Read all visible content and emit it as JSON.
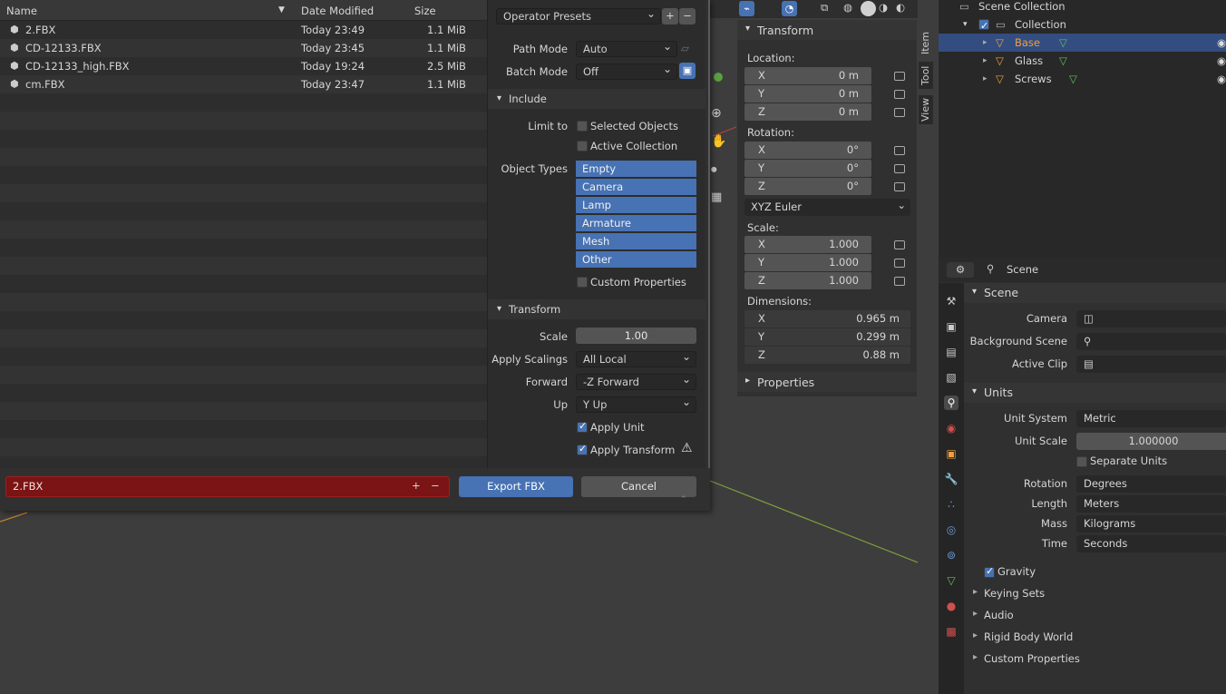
{
  "file_browser": {
    "columns": {
      "name": "Name",
      "date": "Date Modified",
      "size": "Size"
    },
    "files": [
      {
        "name": "2.FBX",
        "date": "Today 23:49",
        "size": "1.1 MiB"
      },
      {
        "name": "CD-12133.FBX",
        "date": "Today 23:45",
        "size": "1.1 MiB"
      },
      {
        "name": "CD-12133_high.FBX",
        "date": "Today 19:24",
        "size": "2.5 MiB"
      },
      {
        "name": "cm.FBX",
        "date": "Today 23:47",
        "size": "1.1 MiB"
      }
    ],
    "filename": "2.FBX",
    "export_label": "Export FBX",
    "cancel_label": "Cancel"
  },
  "export_options": {
    "operator_presets": "Operator Presets",
    "path_mode_label": "Path Mode",
    "path_mode": "Auto",
    "batch_mode_label": "Batch Mode",
    "batch_mode": "Off",
    "include_header": "Include",
    "limit_to_label": "Limit to",
    "selected_objects": "Selected Objects",
    "active_collection": "Active Collection",
    "object_types_label": "Object Types",
    "object_types": [
      "Empty",
      "Camera",
      "Lamp",
      "Armature",
      "Mesh",
      "Other"
    ],
    "custom_properties": "Custom Properties",
    "transform_header": "Transform",
    "scale_label": "Scale",
    "scale": "1.00",
    "apply_scalings_label": "Apply Scalings",
    "apply_scalings": "All Local",
    "forward_label": "Forward",
    "forward": "-Z Forward",
    "up_label": "Up",
    "up": "Y Up",
    "apply_unit": "Apply Unit",
    "apply_transform": "Apply Transform"
  },
  "n_panel": {
    "transform_header": "Transform",
    "location_label": "Location:",
    "location": [
      {
        "axis": "X",
        "value": "0 m"
      },
      {
        "axis": "Y",
        "value": "0 m"
      },
      {
        "axis": "Z",
        "value": "0 m"
      }
    ],
    "rotation_label": "Rotation:",
    "rotation": [
      {
        "axis": "X",
        "value": "0°"
      },
      {
        "axis": "Y",
        "value": "0°"
      },
      {
        "axis": "Z",
        "value": "0°"
      }
    ],
    "rotation_mode": "XYZ Euler",
    "scale_label": "Scale:",
    "scale": [
      {
        "axis": "X",
        "value": "1.000"
      },
      {
        "axis": "Y",
        "value": "1.000"
      },
      {
        "axis": "Z",
        "value": "1.000"
      }
    ],
    "dimensions_label": "Dimensions:",
    "dimensions": [
      {
        "axis": "X",
        "value": "0.965 m"
      },
      {
        "axis": "Y",
        "value": "0.299 m"
      },
      {
        "axis": "Z",
        "value": "0.88 m"
      }
    ],
    "properties_header": "Properties",
    "tabs": [
      "Item",
      "Tool",
      "View"
    ]
  },
  "outliner": {
    "scene_collection": "Scene Collection",
    "collection": "Collection",
    "objects": [
      "Base",
      "Glass",
      "Screws"
    ]
  },
  "properties": {
    "context": "Scene",
    "scene_header": "Scene",
    "camera_label": "Camera",
    "background_scene_label": "Background Scene",
    "active_clip_label": "Active Clip",
    "units_header": "Units",
    "unit_system_label": "Unit System",
    "unit_system": "Metric",
    "unit_scale_label": "Unit Scale",
    "unit_scale": "1.000000",
    "separate_units": "Separate Units",
    "rotation_label": "Rotation",
    "rotation": "Degrees",
    "length_label": "Length",
    "length": "Meters",
    "mass_label": "Mass",
    "mass": "Kilograms",
    "time_label": "Time",
    "time": "Seconds",
    "sections": [
      "Gravity",
      "Keying Sets",
      "Audio",
      "Rigid Body World",
      "Custom Properties"
    ]
  }
}
